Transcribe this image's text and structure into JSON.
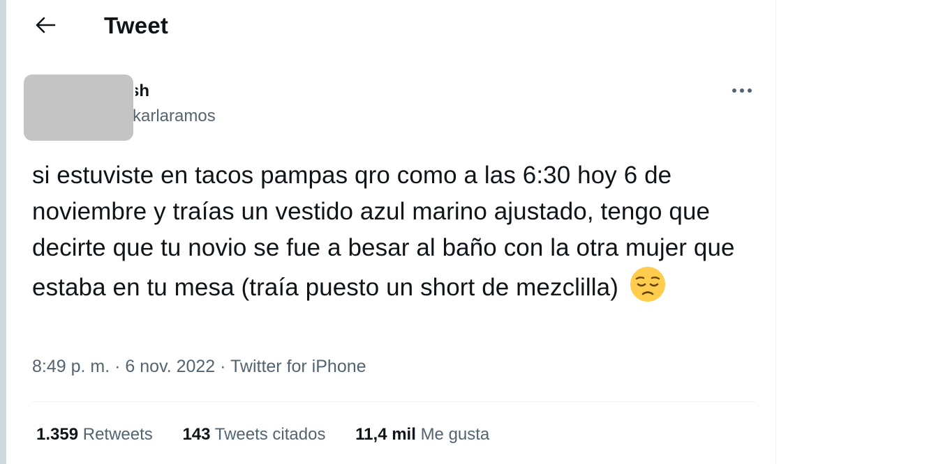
{
  "header": {
    "title": "Tweet",
    "back_icon": "arrow-left-icon"
  },
  "author": {
    "display_name": "sh",
    "handle": "karlaramos"
  },
  "tweet": {
    "text": "si estuviste en tacos pampas qro como a las 6:30 hoy 6 de noviembre y traías un vestido azul marino ajustado, tengo que decirte que tu novio se fue a besar al baño con la otra mujer que estaba en tu mesa (traía puesto un short de mezclilla)",
    "emoji": "pensive-face-emoji",
    "time": "8:49 p. m.",
    "separator": "·",
    "date": "6 nov. 2022",
    "source": "Twitter for iPhone"
  },
  "stats": {
    "retweets_count": "1.359",
    "retweets_label": "Retweets",
    "quotes_count": "143",
    "quotes_label": "Tweets citados",
    "likes_count": "11,4 mil",
    "likes_label": "Me gusta"
  },
  "colors": {
    "text_primary": "#0f1419",
    "text_secondary": "#536471",
    "divider": "#eff3f4",
    "emoji_face": "#ffcc4d"
  }
}
